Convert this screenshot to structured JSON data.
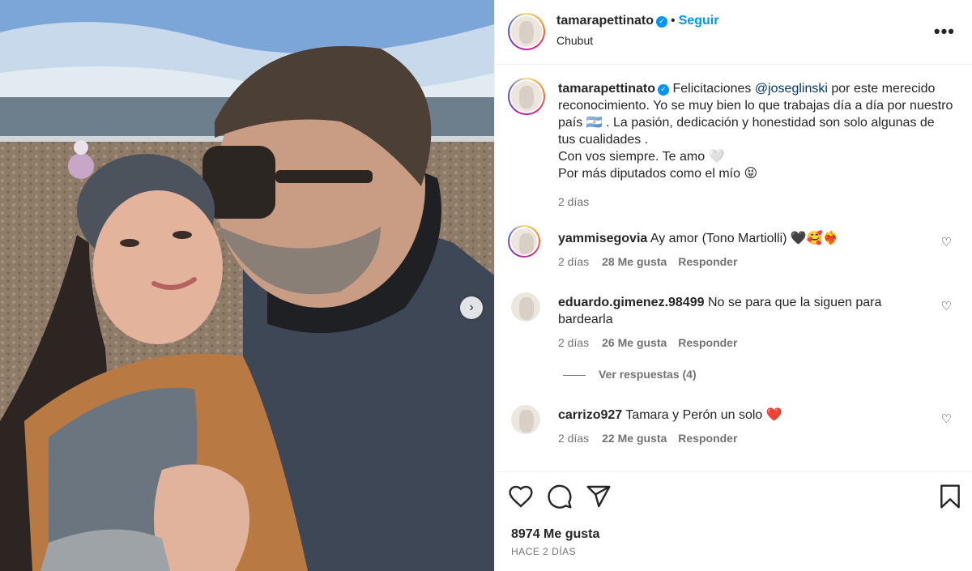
{
  "post": {
    "username": "tamarapettinato",
    "follow_label": "Seguir",
    "location": "Chubut",
    "more_icon": "ellipsis-icon",
    "photo_next_icon": "chevron-right-icon"
  },
  "caption": {
    "username": "tamarapettinato",
    "text_before_mention": "Felicitaciones ",
    "mention": "@joseglinski",
    "text_after_mention": " por este merecido reconocimiento. Yo se muy bien lo que trabajas día a día por nuestro país 🇦🇷 . La pasión, dedicación y honestidad son solo algunas de tus cualidades .",
    "line2": "Con vos siempre. Te amo 🤍",
    "line3": "Por más diputados como el mío 😝",
    "time": "2 días"
  },
  "comments": [
    {
      "username": "yammisegovia",
      "text": "Ay amor (Tono Martiolli) 🖤🥰❤️‍🔥",
      "time": "2 días",
      "likes": "28 Me gusta",
      "reply": "Responder"
    },
    {
      "username": "eduardo.gimenez.98499",
      "text": "No se para que la siguen para bardearla",
      "time": "2 días",
      "likes": "26 Me gusta",
      "reply": "Responder",
      "view_replies": "Ver respuestas (4)"
    },
    {
      "username": "carrizo927",
      "text": "Tamara y Perón un solo ❤️",
      "time": "2 días",
      "likes": "22 Me gusta",
      "reply": "Responder"
    }
  ],
  "footer": {
    "likes": "8974 Me gusta",
    "posted": "HACE 2 DÍAS",
    "icons": [
      "heart-icon",
      "comment-icon",
      "share-icon",
      "bookmark-icon"
    ]
  },
  "colors": {
    "accent": "#0095f6",
    "text": "#262626",
    "secondary": "#737373",
    "mention": "#00376b"
  }
}
